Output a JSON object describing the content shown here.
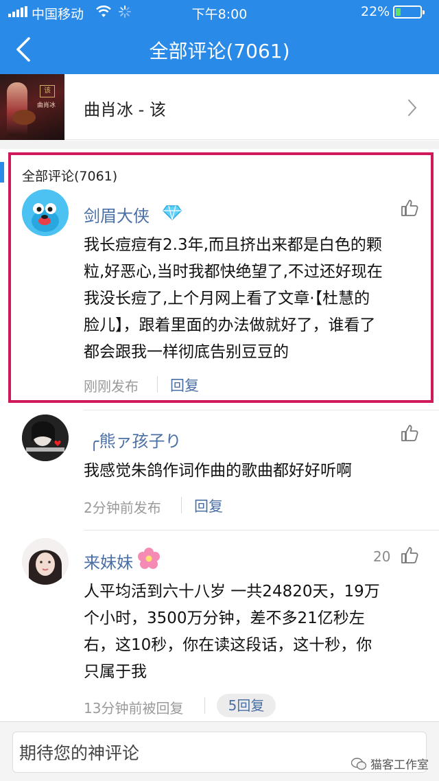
{
  "status_bar": {
    "carrier": "中国移动",
    "time": "下午8:00",
    "battery": "22%",
    "battery_level": 0.22
  },
  "nav": {
    "title": "全部评论(7061)",
    "back_icon": "chevron-left-icon"
  },
  "song": {
    "title": "曲肖冰 - 该",
    "cover_badge": "该",
    "cover_text": "曲肖冰"
  },
  "section": {
    "label": "全部评论(7061)"
  },
  "comments": [
    {
      "user": "剑眉大侠",
      "badge_icon": "diamond-icon",
      "text_lines": [
        "我长痘痘有2.3年,而且挤出来都是白色的颗",
        "粒,好恶心,当时我都快绝望了,不过还好现在",
        "我没长痘了,上个月网上看了文章·【杜慧的",
        "脸儿】，跟着里面的办法做就好了，谁看了",
        "都会跟我一样彻底告别豆豆的"
      ],
      "time": "刚刚发布",
      "reply_label": "回复",
      "likes": ""
    },
    {
      "user": "╭熊ァ孩子り",
      "text_lines": [
        "我感觉朱鸽作词作曲的歌曲都好好听啊"
      ],
      "time": "2分钟前发布",
      "reply_label": "回复",
      "likes": ""
    },
    {
      "user": "来妹妹",
      "badge_icon": "flower-icon",
      "text_lines": [
        "人平均活到六十八岁 一共24820天，19万",
        "个小时，3500万分钟，差不多21亿秒左",
        "右，这10秒，你在读这段话，这十秒，你",
        "只属于我"
      ],
      "time": "13分钟前被回复",
      "reply_count_label": "5回复",
      "likes": "20"
    }
  ],
  "input": {
    "placeholder": "期待您的神评论"
  },
  "watermark": {
    "text": "猫客工作室"
  },
  "colors": {
    "nav_blue": "#2a8ae8",
    "highlight_red": "#d1185a",
    "link_blue": "#4a6fa5"
  }
}
